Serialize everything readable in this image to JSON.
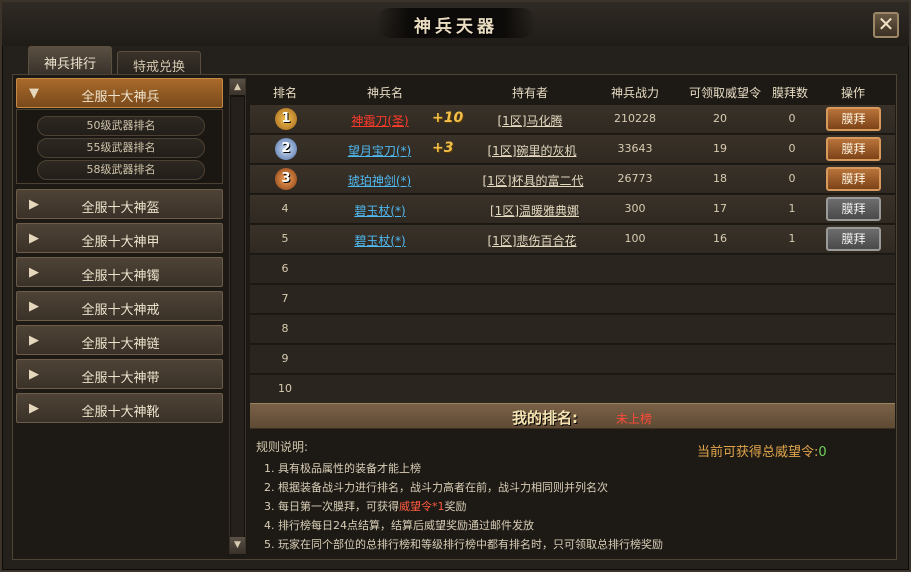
{
  "window": {
    "title": "神兵天器",
    "close_icon": "close-icon"
  },
  "tabs": [
    {
      "label": "神兵排行",
      "active": true
    },
    {
      "label": "特戒兑换",
      "active": false
    }
  ],
  "categories": [
    {
      "label": "全服十大神兵",
      "expanded": true
    },
    {
      "label": "全服十大神盔",
      "expanded": false
    },
    {
      "label": "全服十大神甲",
      "expanded": false
    },
    {
      "label": "全服十大神镯",
      "expanded": false
    },
    {
      "label": "全服十大神戒",
      "expanded": false
    },
    {
      "label": "全服十大神链",
      "expanded": false
    },
    {
      "label": "全服十大神带",
      "expanded": false
    },
    {
      "label": "全服十大神靴",
      "expanded": false
    }
  ],
  "subcategories": [
    "50级武器排名",
    "55级武器排名",
    "58级武器排名"
  ],
  "table": {
    "headers": [
      "排名",
      "神兵名",
      "持有者",
      "神兵战力",
      "可领取威望令",
      "膜拜数",
      "操作"
    ],
    "rows": [
      {
        "rank": "1",
        "weapon": "神霜刀(圣)",
        "weapon_color": "#ff3b2b",
        "plus": "+10",
        "owner": "[1区]马化腾",
        "power": "210228",
        "prestige": "20",
        "worship_count": "0",
        "action": "膜拜",
        "action_enabled": true
      },
      {
        "rank": "2",
        "weapon": "望月宝刀(*)",
        "weapon_color": "#4fb9f2",
        "plus": "+3",
        "owner": "[1区]碗里的灰机",
        "power": "33643",
        "prestige": "19",
        "worship_count": "0",
        "action": "膜拜",
        "action_enabled": true
      },
      {
        "rank": "3",
        "weapon": "琥珀神剑(*)",
        "weapon_color": "#4fb9f2",
        "plus": "",
        "owner": "[1区]杯具的富二代",
        "power": "26773",
        "prestige": "18",
        "worship_count": "0",
        "action": "膜拜",
        "action_enabled": true
      },
      {
        "rank": "4",
        "weapon": "碧玉杖(*)",
        "weapon_color": "#4fb9f2",
        "plus": "",
        "owner": "[1区]温暖雅典娜",
        "power": "300",
        "prestige": "17",
        "worship_count": "1",
        "action": "膜拜",
        "action_enabled": false
      },
      {
        "rank": "5",
        "weapon": "碧玉杖(*)",
        "weapon_color": "#4fb9f2",
        "plus": "",
        "owner": "[1区]悲伤百合花",
        "power": "100",
        "prestige": "16",
        "worship_count": "1",
        "action": "膜拜",
        "action_enabled": false
      },
      {
        "rank": "6"
      },
      {
        "rank": "7"
      },
      {
        "rank": "8"
      },
      {
        "rank": "9"
      },
      {
        "rank": "10"
      }
    ]
  },
  "my_rank": {
    "label": "我的排名:",
    "value": "未上榜"
  },
  "rules": {
    "title": "规则说明:",
    "items": [
      "1. 具有极品属性的装备才能上榜",
      "2. 根据装备战斗力进行排名，战斗力高者在前，战斗力相同则并列名次",
      "3. 每日第一次膜拜，可获得",
      "4. 排行榜每日24点结算，结算后威望奖励通过邮件发放",
      "5. 玩家在同个部位的总排行榜和等级排行榜中都有排名时，只可领取总排行榜奖励"
    ],
    "rule3_highlight": "威望令*1",
    "rule3_suffix": "奖励"
  },
  "total_prestige": {
    "label": "当前可获得总威望令:",
    "value": "0"
  },
  "colors": {
    "accent": "#c57a35",
    "highlight": "#ff5a3f",
    "green": "#6fd35a",
    "gold": "#f2c04a"
  }
}
